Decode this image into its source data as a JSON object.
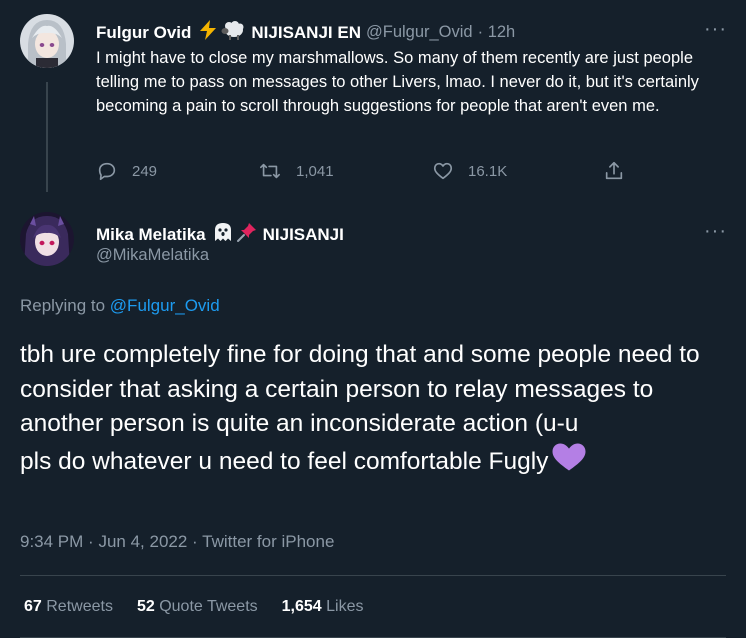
{
  "original_tweet": {
    "display_name": "Fulgur Ovid",
    "name_suffix": "NIJISANJI EN",
    "handle": "@Fulgur_Ovid",
    "time_ago": "· 12h",
    "text": "I might have to close my marshmallows. So many of them recently are just people telling me to pass on messages to other Livers, lmao. I never do it, but it's certainly becoming a pain to scroll through suggestions for people that aren't even me.",
    "replies": "249",
    "retweets": "1,041",
    "likes": "16.1K",
    "more": "···"
  },
  "reply_tweet": {
    "display_name": "Mika Melatika",
    "name_suffix": "NIJISANJI",
    "handle": "@MikaMelatika",
    "more": "···",
    "replying_prefix": "Replying to",
    "replying_to": "@Fulgur_Ovid",
    "text": "tbh ure completely fine for doing that and some people need to consider that asking a certain person to relay messages to another person is quite an inconsiderate action (u-u\npls do whatever u need to feel comfortable Fugly",
    "time": "9:34 PM",
    "date": "Jun 4, 2022",
    "source": "Twitter for iPhone",
    "separator": "·"
  },
  "stats": {
    "retweets_count": "67",
    "retweets_label": "Retweets",
    "quotes_count": "52",
    "quotes_label": "Quote Tweets",
    "likes_count": "1,654",
    "likes_label": "Likes"
  },
  "colors": {
    "background": "#15202b",
    "muted": "#8b98a5",
    "link": "#1d9bf0",
    "divider": "#38444d",
    "heart": "#b47fe5"
  },
  "icons": [
    "lightning-emoji",
    "sheep-emoji",
    "ghost-emoji",
    "pushpin-emoji",
    "purple-heart-emoji",
    "reply-icon",
    "retweet-icon",
    "like-icon",
    "share-icon",
    "more-icon"
  ]
}
